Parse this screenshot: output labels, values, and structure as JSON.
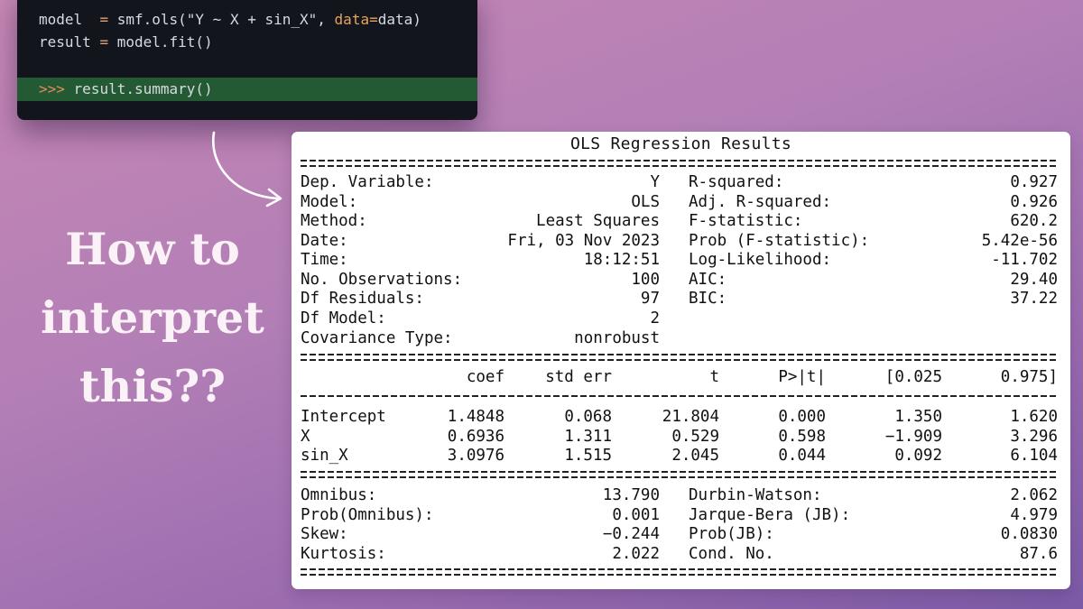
{
  "code": {
    "line1": {
      "name": "model",
      "op": "=",
      "call": "smf.ols(\"Y ~ X + sin_X\", ",
      "kw": "data",
      "kw_op": "=",
      "arg": "data)"
    },
    "line2": {
      "name": "result",
      "op": "=",
      "call": "model.fit()"
    },
    "prompt": {
      "symbol": ">>>",
      "call": "result.summary()"
    }
  },
  "heading": {
    "line1": "How to",
    "line2": "interpret",
    "line3": "this??"
  },
  "results": {
    "title": "OLS Regression Results",
    "top_left": [
      {
        "label": "Dep. Variable:",
        "value": "Y"
      },
      {
        "label": "Model:",
        "value": "OLS"
      },
      {
        "label": "Method:",
        "value": "Least Squares"
      },
      {
        "label": "Date:",
        "value": "Fri, 03 Nov 2023"
      },
      {
        "label": "Time:",
        "value": "18:12:51"
      },
      {
        "label": "No. Observations:",
        "value": "100"
      },
      {
        "label": "Df Residuals:",
        "value": "97"
      },
      {
        "label": "Df Model:",
        "value": "2"
      },
      {
        "label": "Covariance Type:",
        "value": "nonrobust"
      }
    ],
    "top_right": [
      {
        "label": "R-squared:",
        "value": "0.927"
      },
      {
        "label": "Adj. R-squared:",
        "value": "0.926"
      },
      {
        "label": "F-statistic:",
        "value": "620.2"
      },
      {
        "label": "Prob (F-statistic):",
        "value": "5.42e-56"
      },
      {
        "label": "Log-Likelihood:",
        "value": "-11.702"
      },
      {
        "label": "AIC:",
        "value": "29.40"
      },
      {
        "label": "BIC:",
        "value": "37.22"
      }
    ],
    "coef_headers": [
      "coef",
      "std err",
      "t",
      "P>|t|",
      "[0.025",
      "0.975]"
    ],
    "coef_rows": [
      {
        "name": "Intercept",
        "values": [
          "1.4848",
          "0.068",
          "21.804",
          "0.000",
          "1.350",
          "1.620"
        ]
      },
      {
        "name": "X",
        "values": [
          "0.6936",
          "1.311",
          "0.529",
          "0.598",
          "−1.909",
          "3.296"
        ]
      },
      {
        "name": "sin_X",
        "values": [
          "3.0976",
          "1.515",
          "2.045",
          "0.044",
          "0.092",
          "6.104"
        ]
      }
    ],
    "bottom_left": [
      {
        "label": "Omnibus:",
        "value": "13.790"
      },
      {
        "label": "Prob(Omnibus):",
        "value": "0.001"
      },
      {
        "label": "Skew:",
        "value": "−0.244"
      },
      {
        "label": "Kurtosis:",
        "value": "2.022"
      }
    ],
    "bottom_right": [
      {
        "label": "Durbin-Watson:",
        "value": "2.062"
      },
      {
        "label": "Jarque-Bera (JB):",
        "value": "4.979"
      },
      {
        "label": "Prob(JB):",
        "value": "0.0830"
      },
      {
        "label": "Cond. No.",
        "value": "87.6"
      }
    ]
  }
}
